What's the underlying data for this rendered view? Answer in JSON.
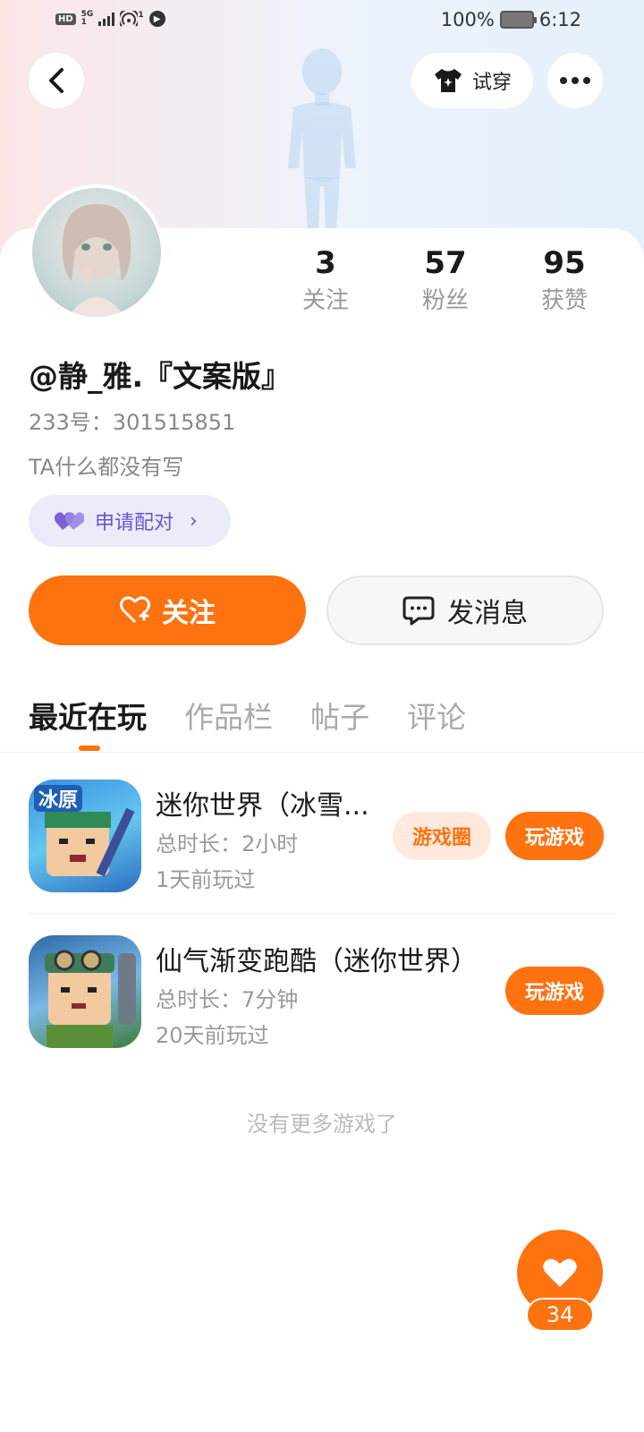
{
  "status_bar": {
    "left_hd": "HD",
    "left_net": "5G",
    "left_net_sub": "1",
    "hotspot_sup": "1",
    "battery_percent": "100%",
    "time": "6:12"
  },
  "header": {
    "back_icon": "chevron-left-icon",
    "tryon_label": "试穿",
    "tryon_icon": "tshirt-icon",
    "more_icon": "more-dots-icon"
  },
  "profile": {
    "username": "@静_雅.『文案版』",
    "uid_label": "233号：301515851",
    "bio": "TA什么都没有写",
    "stats": [
      {
        "num": "3",
        "label": "关注"
      },
      {
        "num": "57",
        "label": "粉丝"
      },
      {
        "num": "95",
        "label": "获赞"
      }
    ],
    "pair_label": "申请配对",
    "pair_chevron": "›"
  },
  "actions": {
    "follow_label": "关注",
    "message_label": "发消息"
  },
  "tabs": [
    {
      "label": "最近在玩",
      "active": true
    },
    {
      "label": "作品栏",
      "active": false
    },
    {
      "label": "帖子",
      "active": false
    },
    {
      "label": "评论",
      "active": false
    }
  ],
  "games": [
    {
      "title": "迷你世界（冰雪...",
      "duration": "总时长：2小时",
      "last_played": "1天前玩过",
      "icon_text": "冰原",
      "circle_label": "游戏圈",
      "play_label": "玩游戏"
    },
    {
      "title": "仙气渐变跑酷（迷你世界）",
      "duration": "总时长：7分钟",
      "last_played": "20天前玩过",
      "play_label": "玩游戏"
    }
  ],
  "no_more_text": "没有更多游戏了",
  "like_fab": {
    "count": "34"
  },
  "colors": {
    "accent": "#ff7210",
    "pair_purple": "#6a55cc",
    "pair_bg": "#ecebfa"
  }
}
